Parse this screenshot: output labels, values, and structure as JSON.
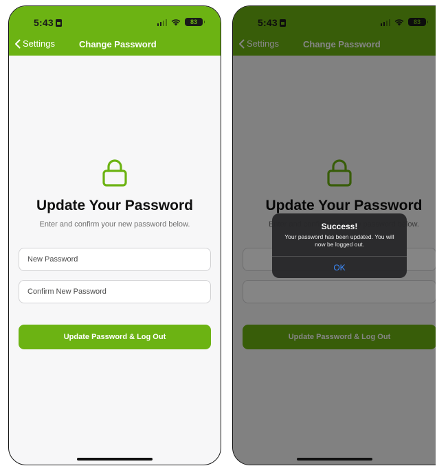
{
  "status_bar": {
    "time": "5:43",
    "battery": "83"
  },
  "nav": {
    "back_label": "Settings",
    "title": "Change Password"
  },
  "form": {
    "heading": "Update Your Password",
    "subheading": "Enter and confirm your new password below.",
    "new_password_placeholder": "New Password",
    "confirm_password_placeholder": "Confirm New Password",
    "submit_label": "Update Password & Log Out"
  },
  "alert": {
    "title": "Success!",
    "message": "Your password has been updated. You will now be logged out.",
    "ok_label": "OK"
  },
  "colors": {
    "brand_green": "#6cb313",
    "alert_link_blue": "#3d8cff"
  }
}
